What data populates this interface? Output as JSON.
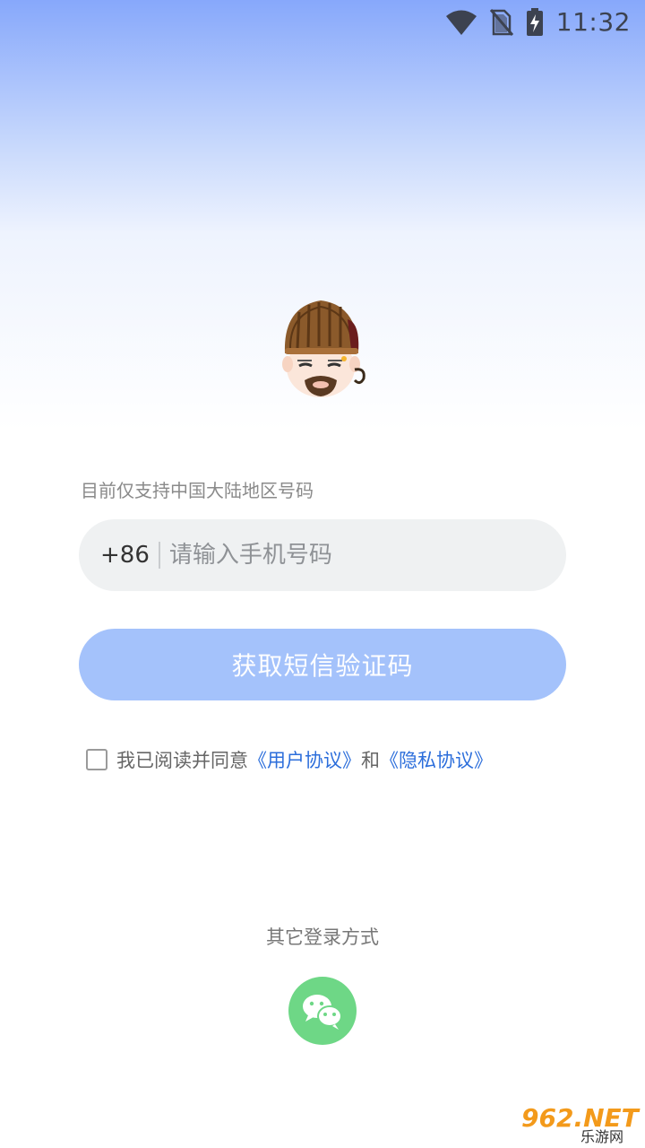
{
  "status_bar": {
    "time": "11:32",
    "icons": [
      "wifi-icon",
      "no-sim-icon",
      "battery-charging-icon"
    ]
  },
  "login": {
    "avatar_icon": "character-avatar",
    "region_note": "目前仅支持中国大陆地区号码",
    "country_code": "+86",
    "phone_placeholder": "请输入手机号码",
    "sms_button_label": "获取短信验证码",
    "agreement": {
      "checked": false,
      "prefix": "我已阅读并同意",
      "user_agreement": "《用户协议》",
      "and": "和",
      "privacy_policy": "《隐私协议》"
    },
    "other_login_label": "其它登录方式",
    "wechat_icon": "wechat-icon"
  },
  "watermark": {
    "main": "962.NET",
    "sub": "乐游网"
  },
  "colors": {
    "accent_button": "#a4c2fb",
    "link": "#2c6edb",
    "wechat": "#6ed786",
    "field_bg": "#eff1f2"
  }
}
